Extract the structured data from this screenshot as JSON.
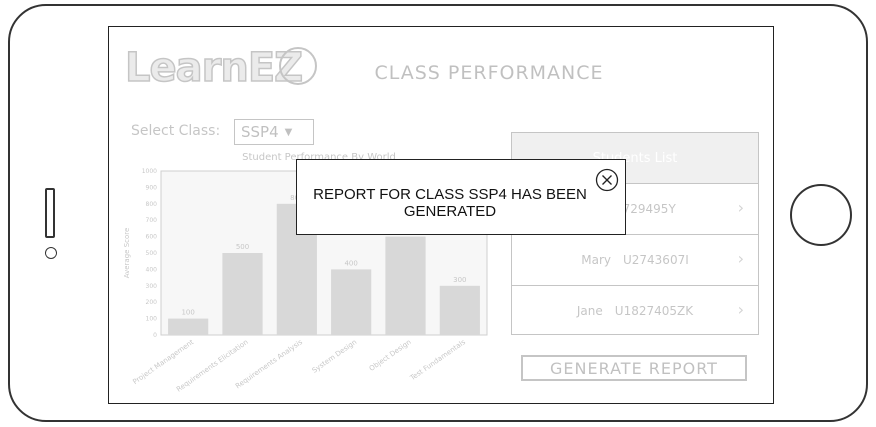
{
  "app": {
    "logo_text": "LearnEZ",
    "page_title": "CLASS PERFORMANCE"
  },
  "class_select": {
    "label": "Select Class:",
    "value": "SSP4"
  },
  "chart_data": {
    "type": "bar",
    "title": "Student Performance By World",
    "ylabel": "Average Score",
    "ylim": [
      0,
      1000
    ],
    "yticks": [
      "0",
      "100",
      "200",
      "300",
      "400",
      "500",
      "600",
      "700",
      "800",
      "900",
      "1000"
    ],
    "categories": [
      "Project Management",
      "Requirements Elicitation",
      "Requirements Analysis",
      "System Design",
      "Object Design",
      "Test Fundamentals"
    ],
    "values": [
      100,
      500,
      800,
      400,
      600,
      300
    ],
    "data_labels": [
      "100",
      "500",
      "800",
      "400",
      "",
      "300"
    ]
  },
  "students": {
    "header": "Students List",
    "items": [
      {
        "name": "",
        "id": "U1729495Y"
      },
      {
        "name": "Mary",
        "id": "U2743607I"
      },
      {
        "name": "Jane",
        "id": "U1827405ZK"
      }
    ]
  },
  "generate_button": {
    "label": "GENERATE REPORT"
  },
  "modal": {
    "message": "REPORT FOR CLASS SSP4 HAS BEEN GENERATED"
  }
}
